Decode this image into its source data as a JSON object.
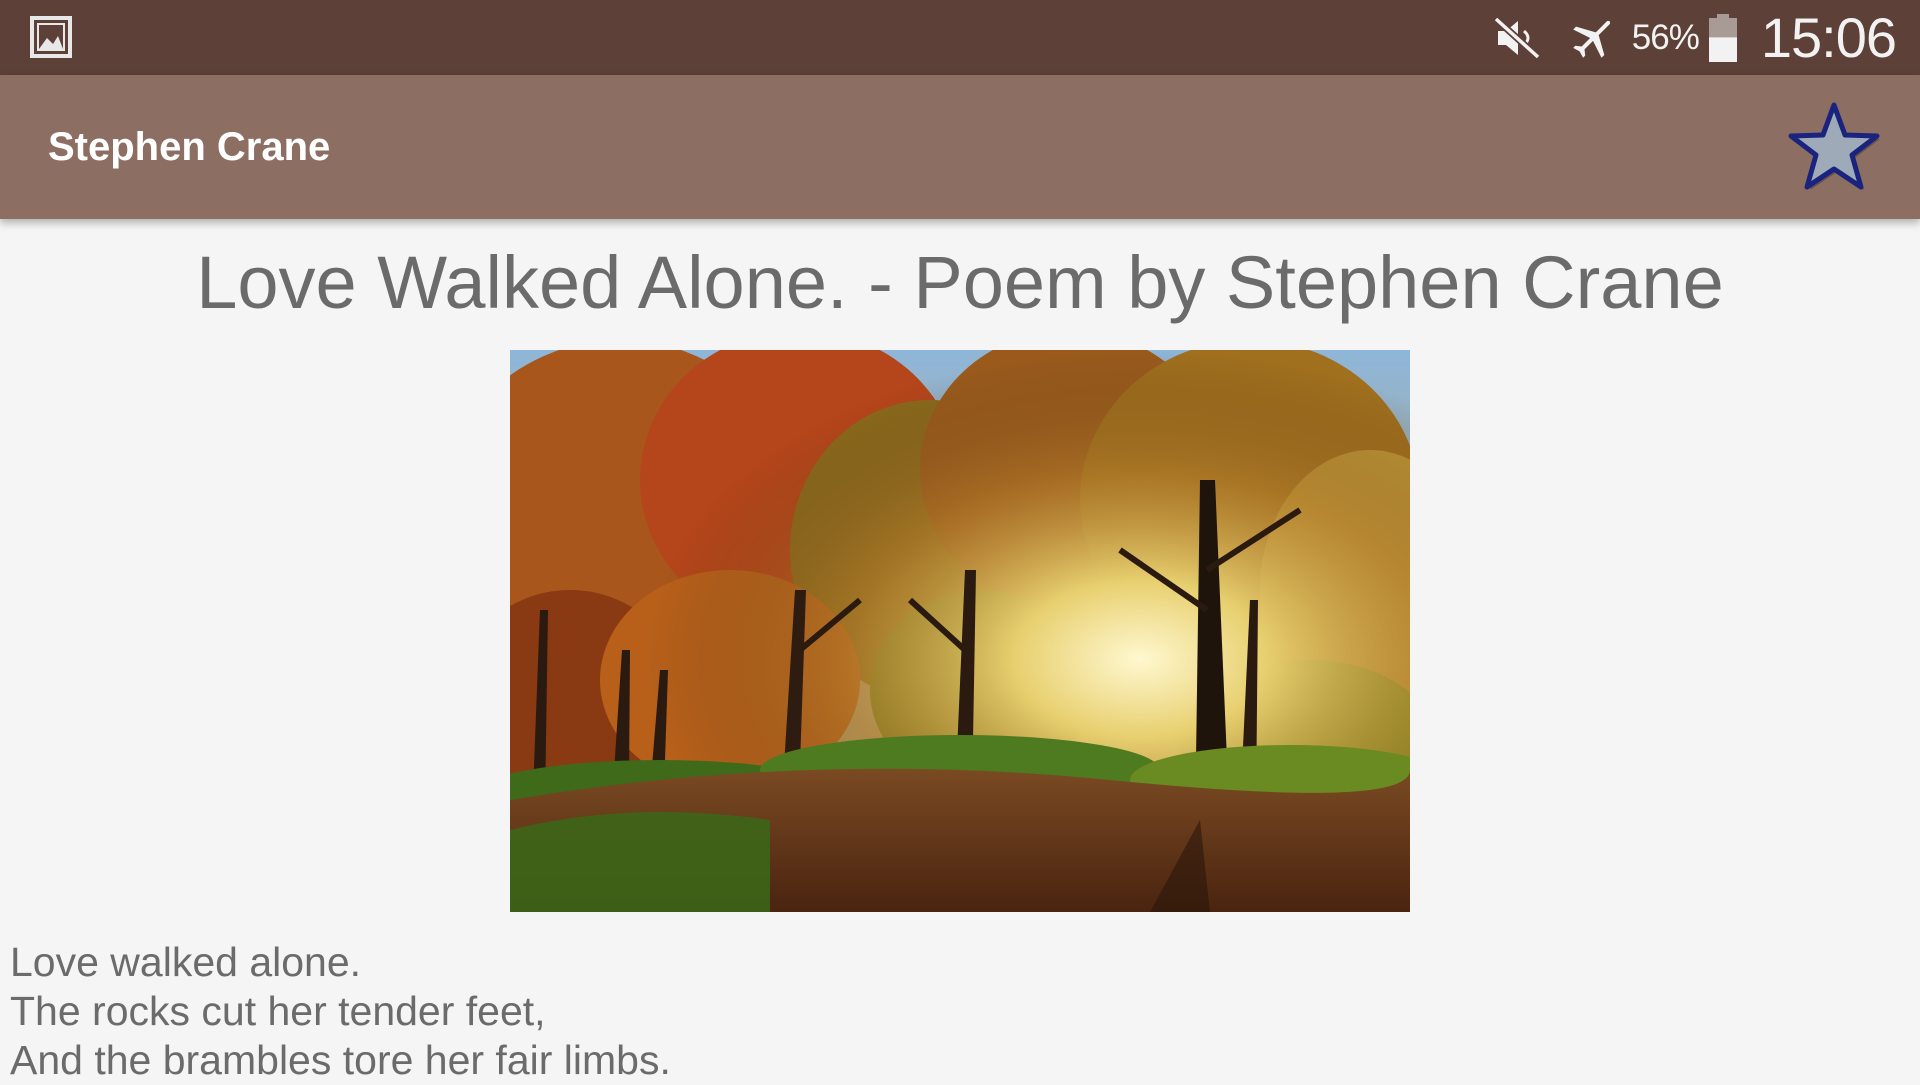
{
  "status_bar": {
    "notification_icon": "gallery-icon",
    "mute_icon": "mute-icon",
    "airplane_icon": "airplane-icon",
    "battery_percent": "56%",
    "battery_level": 0.56,
    "time": "15:06"
  },
  "app_bar": {
    "title": "Stephen Crane",
    "favorite_icon": "star-icon",
    "colors": {
      "bar": "#8d6e63",
      "status": "#5d4037",
      "star_fill": "#9eaab8",
      "star_stroke": "#1a237e"
    }
  },
  "poem": {
    "title": "Love Walked Alone. - Poem by Stephen Crane",
    "image": "autumn-forest-image",
    "lines": [
      "Love walked alone.",
      "The rocks cut her tender feet,",
      "And the brambles tore her fair limbs."
    ]
  }
}
